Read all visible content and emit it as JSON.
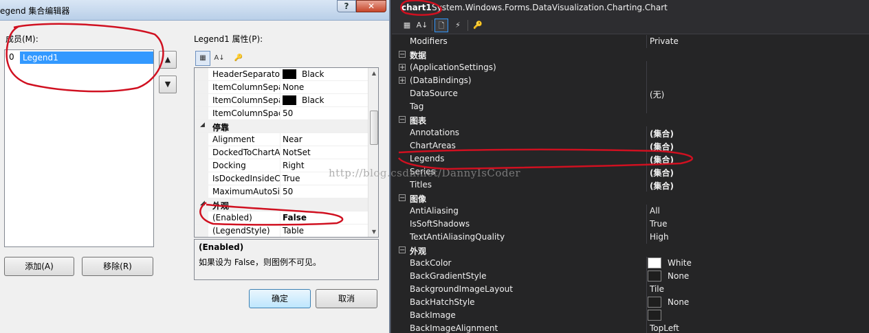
{
  "dialog": {
    "title": "egend 集合编辑器",
    "help_label": "?",
    "close_label": "✕",
    "members_label": "成员(M):",
    "members": [
      {
        "index": "0",
        "name": "Legend1"
      }
    ],
    "move_up": "▲",
    "move_down": "▼",
    "add_button": "添加(A)",
    "remove_button": "移除(R)",
    "ok_button": "确定",
    "cancel_button": "取消",
    "props_label": "Legend1 属性(P):",
    "toolbar": {
      "categorized": "▦",
      "alphabetical": "A↓",
      "property_pages": "🔑"
    },
    "rows": [
      {
        "kind": "prop",
        "name": "HeaderSeparator",
        "value": "Black",
        "swatch": "#000000"
      },
      {
        "kind": "prop",
        "name": "ItemColumnSepa",
        "value": "None"
      },
      {
        "kind": "prop",
        "name": "ItemColumnSepa",
        "value": "Black",
        "swatch": "#000000"
      },
      {
        "kind": "prop",
        "name": "ItemColumnSpac",
        "value": "50"
      },
      {
        "kind": "cat",
        "name": "停靠"
      },
      {
        "kind": "prop",
        "name": "Alignment",
        "value": "Near"
      },
      {
        "kind": "prop",
        "name": "DockedToChartA",
        "value": "NotSet"
      },
      {
        "kind": "prop",
        "name": "Docking",
        "value": "Right"
      },
      {
        "kind": "prop",
        "name": "IsDockedInsideC",
        "value": "True"
      },
      {
        "kind": "prop",
        "name": "MaximumAutoSiz",
        "value": "50"
      },
      {
        "kind": "cat",
        "name": "外观"
      },
      {
        "kind": "prop",
        "name": "(Enabled)",
        "value": "False",
        "bold": true
      },
      {
        "kind": "prop",
        "name": "(LegendStyle)",
        "value": "Table"
      }
    ],
    "description": {
      "title": "(Enabled)",
      "text": "如果设为 False，则图例不可见。"
    }
  },
  "vs": {
    "object_name": "chart1",
    "object_type": "System.Windows.Forms.DataVisualization.Charting.Chart",
    "toolbar": {
      "categorized": "▦",
      "alphabetical": "A↓",
      "properties": "🗋",
      "events": "⚡",
      "property_pages": "🔑"
    },
    "rows": [
      {
        "kind": "prop",
        "name": "Modifiers",
        "value": "Private"
      },
      {
        "kind": "cat",
        "name": "数据"
      },
      {
        "kind": "prop",
        "name": "(ApplicationSettings)",
        "value": "",
        "expand": "+"
      },
      {
        "kind": "prop",
        "name": "(DataBindings)",
        "value": "",
        "expand": "+"
      },
      {
        "kind": "prop",
        "name": "DataSource",
        "value": "(无)"
      },
      {
        "kind": "prop",
        "name": "Tag",
        "value": ""
      },
      {
        "kind": "cat",
        "name": "图表"
      },
      {
        "kind": "prop",
        "name": "Annotations",
        "value": "(集合)",
        "bold": true
      },
      {
        "kind": "prop",
        "name": "ChartAreas",
        "value": "(集合)",
        "bold": true
      },
      {
        "kind": "prop",
        "name": "Legends",
        "value": "(集合)",
        "bold": true
      },
      {
        "kind": "prop",
        "name": "Series",
        "value": "(集合)",
        "bold": true
      },
      {
        "kind": "prop",
        "name": "Titles",
        "value": "(集合)",
        "bold": true
      },
      {
        "kind": "cat",
        "name": "图像"
      },
      {
        "kind": "prop",
        "name": "AntiAliasing",
        "value": "All"
      },
      {
        "kind": "prop",
        "name": "IsSoftShadows",
        "value": "True"
      },
      {
        "kind": "prop",
        "name": "TextAntiAliasingQuality",
        "value": "High"
      },
      {
        "kind": "cat",
        "name": "外观"
      },
      {
        "kind": "prop",
        "name": "BackColor",
        "value": "White",
        "swatch": "#ffffff"
      },
      {
        "kind": "prop",
        "name": "BackGradientStyle",
        "value": "None",
        "swatch": "#1e1e1e"
      },
      {
        "kind": "prop",
        "name": "BackgroundImageLayout",
        "value": "Tile"
      },
      {
        "kind": "prop",
        "name": "BackHatchStyle",
        "value": "None",
        "swatch": "#1e1e1e"
      },
      {
        "kind": "prop",
        "name": "BackImage",
        "value": "",
        "swatch": "#1e1e1e"
      },
      {
        "kind": "prop",
        "name": "BackImageAlignment",
        "value": "TopLeft"
      }
    ]
  },
  "watermark": "http://blog.csdn.net/DannyIsCoder",
  "colors": {
    "selection": "#3399ff",
    "annotation": "#d01020",
    "vs_bg": "#252526"
  }
}
